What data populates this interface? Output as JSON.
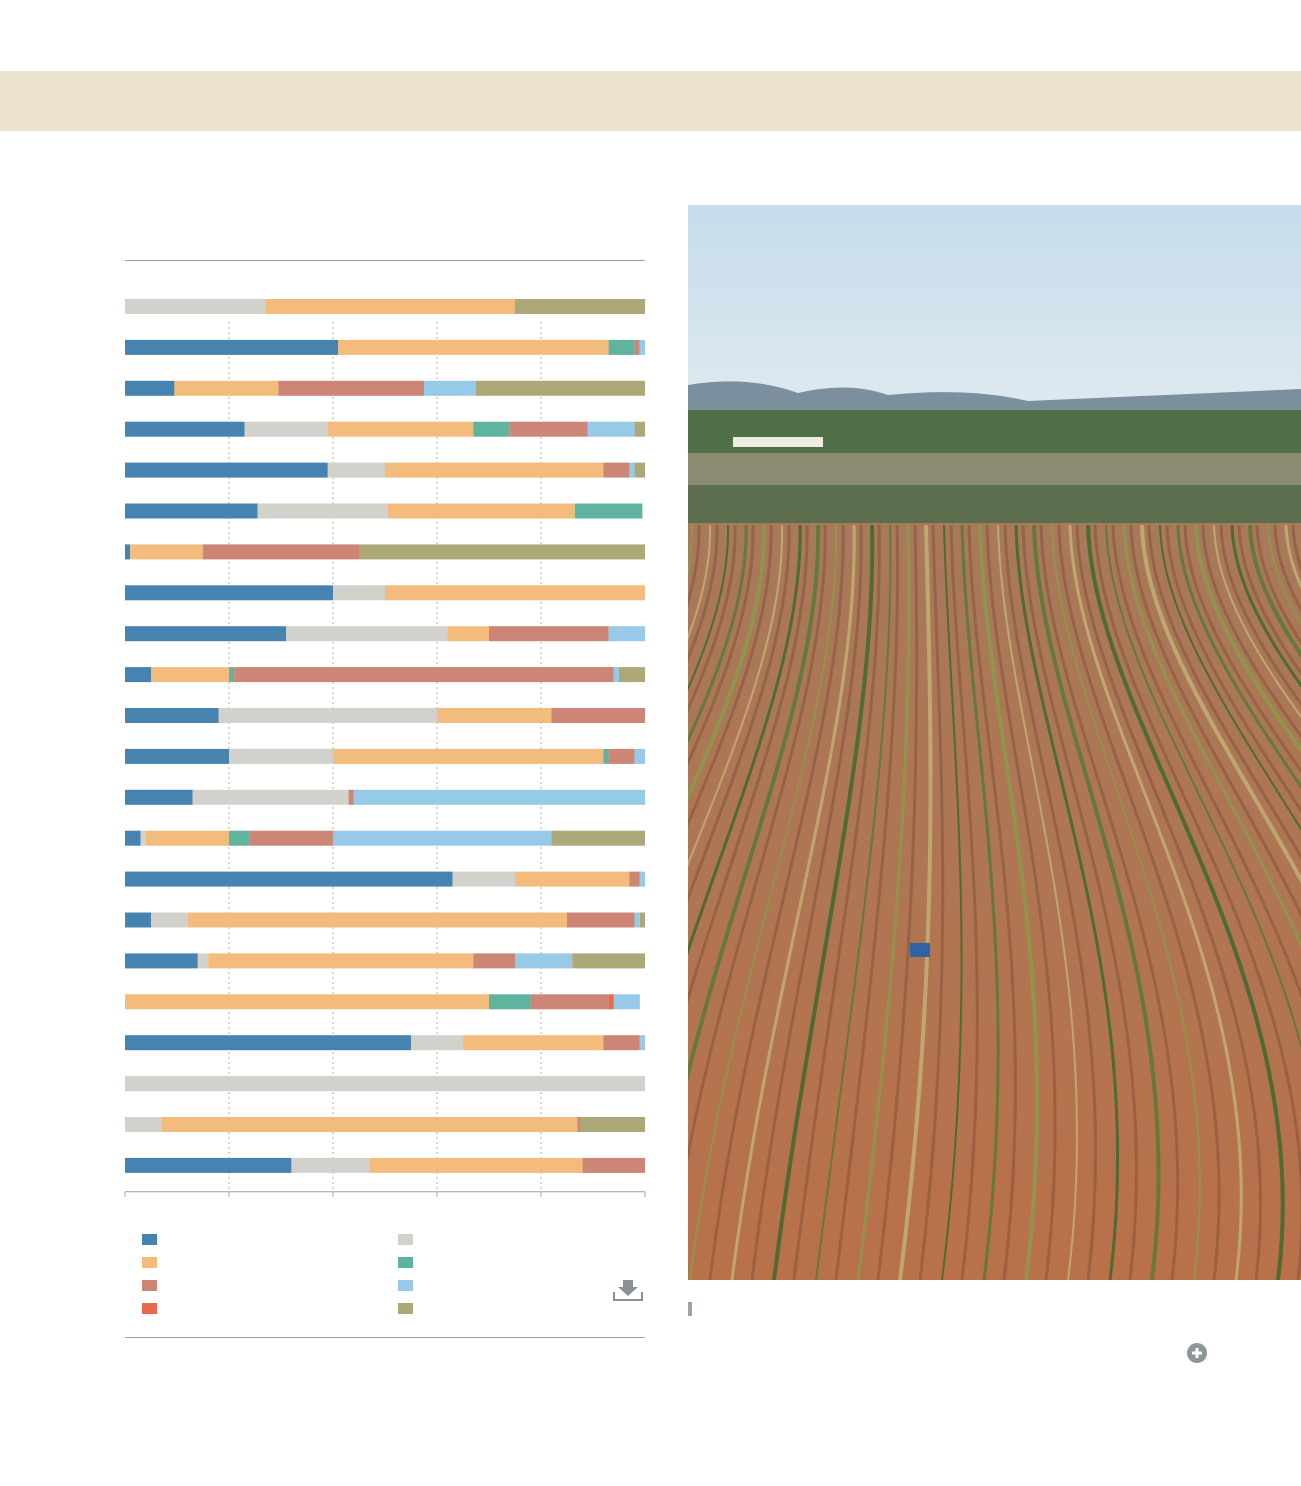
{
  "colors": {
    "band": "#ece2d0",
    "rule": "#9aa3a5",
    "grid": "#b0b0b0"
  },
  "chart_data": {
    "type": "bar",
    "orientation": "horizontal",
    "stacked": true,
    "normalized": true,
    "xlim": [
      0,
      100
    ],
    "grid": true,
    "legend_position": "bottom",
    "series": [
      {
        "color": "#4683b0",
        "values": [
          0,
          41,
          9.5,
          23,
          39,
          25.5,
          1,
          40,
          31,
          5,
          18,
          20,
          13,
          3,
          63,
          5,
          14,
          0,
          55,
          0,
          0,
          32
        ]
      },
      {
        "color": "#d2d1cc",
        "values": [
          27,
          0,
          0,
          16,
          11,
          25,
          0,
          10,
          31,
          0,
          42,
          20,
          30,
          1,
          12,
          7,
          2,
          0,
          10,
          100,
          7,
          15
        ]
      },
      {
        "color": "#f3bb7c",
        "values": [
          48,
          52,
          20,
          28,
          42,
          36,
          14,
          50,
          8,
          15,
          22,
          52,
          0,
          16,
          22,
          73,
          51,
          70,
          27,
          0,
          80,
          41
        ]
      },
      {
        "color": "#5eb49f",
        "values": [
          0,
          5,
          0,
          7,
          0,
          13,
          0,
          0,
          0,
          1,
          0,
          1,
          0,
          4,
          0,
          0,
          0,
          8,
          0,
          0,
          0,
          0
        ]
      },
      {
        "color": "#cd8675",
        "values": [
          0,
          1,
          28,
          15,
          5,
          0,
          30,
          0,
          23,
          73,
          18,
          5,
          1,
          16,
          2,
          13,
          8,
          15,
          7,
          0,
          0.5,
          12
        ]
      },
      {
        "color": "#e8694d",
        "values": [
          0,
          0,
          0,
          0,
          0,
          0,
          0,
          0,
          0,
          0,
          0,
          0,
          0,
          0,
          0,
          0,
          0,
          1,
          0,
          0,
          0,
          0
        ]
      },
      {
        "color": "#96cae8",
        "values": [
          0,
          1,
          10,
          9,
          1,
          0,
          0,
          0,
          7,
          1,
          0,
          2,
          56,
          42,
          1,
          1,
          11,
          5,
          1,
          0,
          0,
          0
        ]
      },
      {
        "color": "#ada878",
        "values": [
          25,
          0,
          32.5,
          2,
          2,
          0,
          55,
          0,
          0,
          5,
          0,
          0,
          0,
          18,
          0,
          1,
          14,
          0,
          0,
          0,
          12.5,
          0
        ]
      }
    ]
  },
  "legend": [
    {
      "color": "#4683b0"
    },
    {
      "color": "#f3bb7c"
    },
    {
      "color": "#cd8675"
    },
    {
      "color": "#e8694d"
    },
    {
      "color": "#d2d1cc"
    },
    {
      "color": "#5eb49f"
    },
    {
      "color": "#96cae8"
    },
    {
      "color": "#ada878"
    }
  ],
  "icons": {
    "download": "download-icon",
    "zoom": "zoom-plus-icon"
  }
}
